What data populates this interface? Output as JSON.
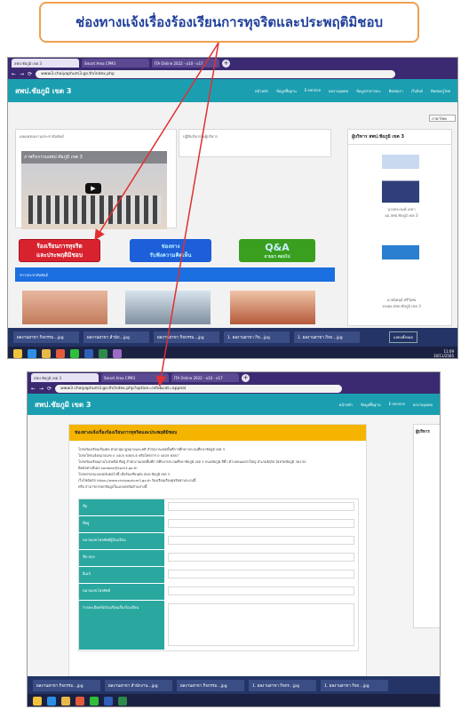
{
  "title": "ช่องทางแจ้งเรื่องร้องเรียนการทุจริตและประพฤติมิชอบ",
  "shot1": {
    "tabs": [
      "สพป.ชัยภูมิ เขต 3",
      "Smart Area CPM3",
      "ITA Online 2022 - o10 - o17"
    ],
    "url": "www3.chaiyaphum3.go.th/index.php",
    "site_name": "สพป.ชัยภูมิ เขต 3",
    "menu": [
      "หน้าหลัก",
      "ข้อมูลพื้นฐาน",
      "E-service",
      "ผลงานบุคคล",
      "ข้อมูลสาธารณะ",
      "ติดต่อเรา",
      "เว็บลิงค์",
      "ติดต่อครูไทย"
    ],
    "video_caption": "ภาพกิจกรรมสพป.ชัยภูมิ เขต 3",
    "news_heading": "เผยแพร่ผลงานประชาสัมพันธ์",
    "calendar_heading": "ปฏิทินกิจกรรมผู้บริหาร",
    "admin_heading": "ผู้บริหาร สพป.ชัยภูมิ เขต 3",
    "admin1": "นายประยงค์ เลขา\nผอ.สพป.ชัยภูมิ เขต 3",
    "admin2": "นายนิพนธ์ ศรีวิเศษ\nรองผอ.สพป.ชัยภูมิ เขต 3",
    "btn_complaint": "ร้องเรียนการทุจริต\nและประพฤติมิชอบ",
    "btn_feedback": "ช่องทาง\nรับฟังความคิดเห็น",
    "btn_qa_title": "Q&A",
    "btn_qa_sub": "ถามมา ตอบไป",
    "blue_heading": "ข่าวประชาสัมพันธ์",
    "lang": "ภาษาไทย",
    "taskbar": [
      "ผลงานสาขา กิจกรรม...jpg",
      "ผลงานสาขา สำนัก...jpg",
      "ผลงานสาขา กิจกรรม...jpg",
      "1. ผลงานสาขา กิจ...jpg",
      "1. ผลงานสาขา กิจก...jpg"
    ],
    "show_all": "แสดงทั้งหมด",
    "clock_time": "11:09",
    "clock_date": "10/11/2565"
  },
  "shot2": {
    "tabs": [
      "สพป.ชัยภูมิ เขต 3",
      "Smart Area CPM3",
      "ITA Online 2022 - o10 - o17"
    ],
    "url": "www3.chaiyaphum3.go.th/index.php?option=info&cat=appeal",
    "site_name": "สพป.ชัยภูมิ เขต 3",
    "menu": [
      "หน้าหลัก",
      "ข้อมูลพื้นฐาน",
      "E-service",
      "ผลงานบุคคล"
    ],
    "form_heading": "ช่องทางแจ้งเรื่องร้องเรียนการทุจริตและประพฤติมิชอบ",
    "side_heading": "ผู้บริหาร",
    "intro": [
      "โปรดร้องเรียนเรื่องต่อ ฝ่ายกลุ่มกฎหมายและคดี สำนักงานเขตพื้นที่การศึกษาประถมศึกษาชัยภูมิ เขต 3",
      "โปรดโทรแจ้งหมายเลข 0 4405 6385-6 หรือโทรสาร 0 4405 6387",
      "โปรดร้องเรียนผ่านไปรษณีย์ ที่อยู่ สำนักงานเขตพื้นที่การศึกษาประถมศึกษาชัยภูมิ เขต 3 ถนนชัยภูมิ-สีคิ้ว ตำบลหนองบัวใหญ่ อำเภอจัตุรัส จังหวัดชัยภูมิ 36130",
      "ติดต่อทางอีเมล saraban@cpm3.go.th",
      "โปรดกรอกแบบฟอร์มต่อไปนี้ เพื่อร้องเรียนต่อ สพป.ชัยภูมิ เขต 3",
      "เว็บไซต์หลัก https://www.chaiyaphum3.go.th ร้องเรียนเรื่องทุจริตผ่านระบบนี้",
      "หรือ สามารถกรอกข้อมูลในแบบฟอร์มด้านล่างนี้"
    ],
    "fields": [
      "ชื่อ",
      "ที่อยู่",
      "หมายเลขโทรศัพท์ผู้ร้องเรียน",
      "ชื่อ-สกุล",
      "อีเมล์",
      "หมายเลขโทรศัพท์",
      "รายละเอียดข้อร้องเรียนเรื่องร้องเรียน"
    ],
    "taskbar": [
      "ผลงานสาขา กิจกรรม...jpg",
      "ผลงานสาขา สำนักงาน...jpg",
      "ผลงานสาขา กิจกรรม...jpg",
      "1. ผลงานสาขา กิจกร...jpg",
      "1. ผลงานสาขา กิจก...jpg"
    ]
  },
  "colors": {
    "title_border": "#f0a050",
    "title_text": "#1f3f9a",
    "site_bar": "#1b9fb0",
    "browser": "#3b2a72",
    "complaint_btn": "#d8232f",
    "feedback_btn": "#1d5fd8",
    "qa_btn": "#3a9e1e",
    "arrow": "#e03030",
    "form_heading_bg": "#f4b400",
    "field_label_bg": "#2aa8a0"
  }
}
